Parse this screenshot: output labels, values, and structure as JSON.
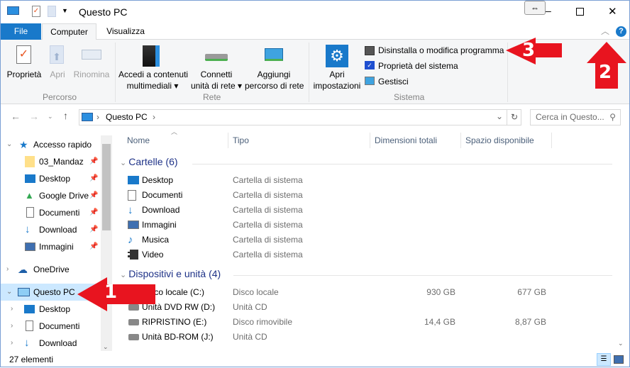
{
  "window": {
    "title": "Questo PC",
    "minimize": "–",
    "maximize": "☐",
    "close": "✕"
  },
  "tabs": {
    "file": "File",
    "computer": "Computer",
    "view": "Visualizza"
  },
  "ribbon": {
    "percorso": {
      "label": "Percorso",
      "properties": "Proprietà",
      "open": "Apri",
      "rename": "Rinomina"
    },
    "rete": {
      "label": "Rete",
      "media_1": "Accedi a contenuti",
      "media_2": "multimediali",
      "map_1": "Connetti",
      "map_2": "unità di rete",
      "add_1": "Aggiungi",
      "add_2": "percorso di rete"
    },
    "sistema": {
      "label": "Sistema",
      "settings_1": "Apri",
      "settings_2": "impostazioni",
      "uninstall": "Disinstalla o modifica programma",
      "sysprops": "Proprietà del sistema",
      "manage": "Gestisci"
    }
  },
  "address": {
    "path": "Questo PC",
    "search_placeholder": "Cerca in Questo..."
  },
  "nav": {
    "quick_access": "Accesso rapido",
    "quick_items": [
      "03_Mandaz",
      "Desktop",
      "Google Drive",
      "Documenti",
      "Download",
      "Immagini"
    ],
    "onedrive": "OneDrive",
    "this_pc": "Questo PC",
    "pc_items": [
      "Desktop",
      "Documenti",
      "Download"
    ]
  },
  "columns": [
    "Nome",
    "Tipo",
    "Dimensioni totali",
    "Spazio disponibile"
  ],
  "folders": {
    "header": "Cartelle (6)",
    "items": [
      {
        "name": "Desktop",
        "type": "Cartella di sistema"
      },
      {
        "name": "Documenti",
        "type": "Cartella di sistema"
      },
      {
        "name": "Download",
        "type": "Cartella di sistema"
      },
      {
        "name": "Immagini",
        "type": "Cartella di sistema"
      },
      {
        "name": "Musica",
        "type": "Cartella di sistema"
      },
      {
        "name": "Video",
        "type": "Cartella di sistema"
      }
    ]
  },
  "devices": {
    "header": "Dispositivi e unità (4)",
    "items": [
      {
        "name": "Disco locale (C:)",
        "type": "Disco locale",
        "total": "930 GB",
        "free": "677 GB"
      },
      {
        "name": "Unità DVD RW (D:)",
        "type": "Unità CD",
        "total": "",
        "free": ""
      },
      {
        "name": "RIPRISTINO (E:)",
        "type": "Disco rimovibile",
        "total": "14,4 GB",
        "free": "8,87 GB"
      },
      {
        "name": "Unità BD-ROM (J:)",
        "type": "Unità CD",
        "total": "",
        "free": ""
      }
    ]
  },
  "status": {
    "count": "27 elementi"
  },
  "annotations": [
    "1",
    "2",
    "3"
  ],
  "colors": {
    "file_tab": "#1979ca",
    "arrow": "#e8141f",
    "selection": "#cce8ff",
    "group_header": "#1e3287"
  }
}
